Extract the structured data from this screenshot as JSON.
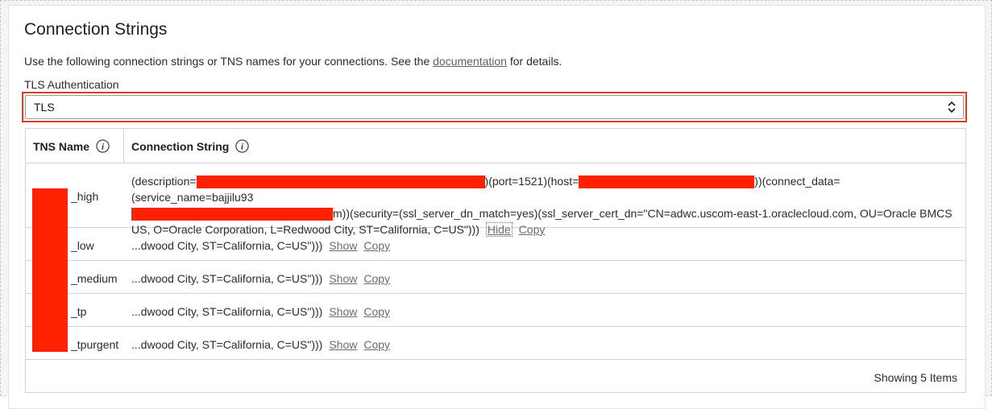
{
  "panel": {
    "title": "Connection Strings",
    "description_prefix": "Use the following connection strings or TNS names for your connections. See the ",
    "description_link": "documentation",
    "description_suffix": " for details."
  },
  "tls": {
    "label": "TLS Authentication",
    "selected": "TLS"
  },
  "table": {
    "headers": {
      "tns_name": "TNS Name",
      "connection_string": "Connection String"
    },
    "rows": [
      {
        "tns": "_high",
        "line1_a": "(description=",
        "line1_b": ")(port=1521)(host=",
        "line1_c": "))(connect_data=(service_name=bajjilu93",
        "line2_a": "m))(security=(ssl_server_dn_match=yes)(ssl_server_cert_dn=\"CN=adwc.uscom-east-1.oraclecloud.com, OU=Oracle BMCS",
        "line3": "US, O=Oracle Corporation, L=Redwood City, ST=California, C=US\")))",
        "toggle": "Hide",
        "copy": "Copy"
      },
      {
        "tns": "_low",
        "truncated": "...dwood City, ST=California, C=US\")))",
        "toggle": "Show",
        "copy": "Copy"
      },
      {
        "tns": "_medium",
        "truncated": "...dwood City, ST=California, C=US\")))",
        "toggle": "Show",
        "copy": "Copy"
      },
      {
        "tns": "_tp",
        "truncated": "...dwood City, ST=California, C=US\")))",
        "toggle": "Show",
        "copy": "Copy"
      },
      {
        "tns": "_tpurgent",
        "truncated": "...dwood City, ST=California, C=US\")))",
        "toggle": "Show",
        "copy": "Copy"
      }
    ],
    "footer": "Showing 5 Items"
  },
  "icons": {
    "info": "info-icon",
    "select": "chevron-up-down-icon"
  },
  "colors": {
    "highlight": "#e33b22",
    "redaction": "#ff2200",
    "link": "#6b6b6b"
  }
}
